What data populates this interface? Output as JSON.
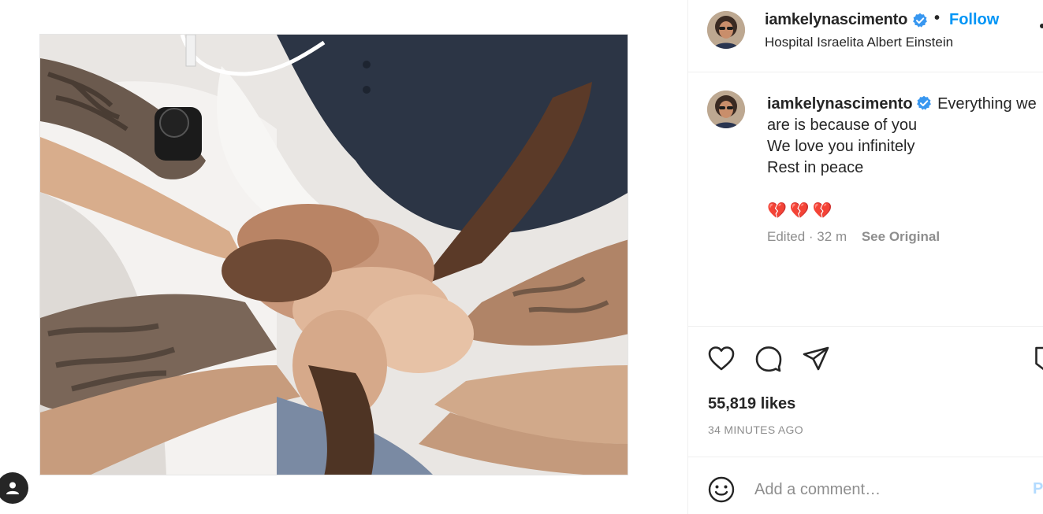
{
  "post": {
    "username": "iamkelynascimento",
    "verified": true,
    "separator": "•",
    "follow_label": "Follow",
    "location": "Hospital Israelita Albert Einstein"
  },
  "caption": {
    "username": "iamkelynascimento",
    "lines": [
      "Everything we are is because of you",
      "We love you infinitely",
      "Rest in peace"
    ],
    "first_line": "Everything we are is because of you",
    "second_line": "We love you infinitely",
    "third_line": "Rest in peace",
    "hearts": [
      "💔",
      "💔",
      "💔"
    ],
    "edited_text": "Edited · 32 m",
    "see_original_label": "See Original"
  },
  "actions": {
    "like_icon": "heart-icon",
    "comment_icon": "comment-icon",
    "share_icon": "paper-plane-icon",
    "save_icon": "bookmark-icon",
    "likes_text": "55,819 likes",
    "timestamp": "34 MINUTES AGO"
  },
  "comment": {
    "placeholder": "Add a comment…",
    "post_label": "Po",
    "emoji_icon": "smiley-icon"
  },
  "colors": {
    "link_blue": "#0095f6",
    "verified_blue": "#3897f0",
    "muted_gray": "#8e8e8e",
    "heart_pink": "#e83a6f"
  }
}
